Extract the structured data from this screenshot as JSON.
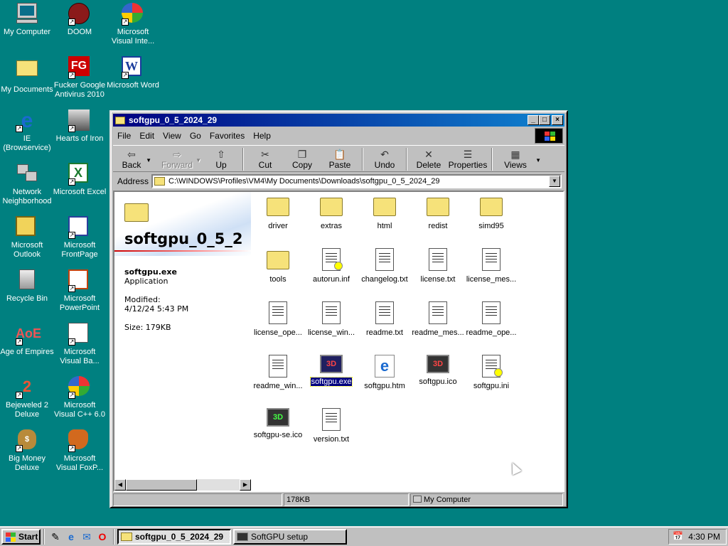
{
  "desktop": {
    "icons": [
      {
        "label": "My Computer",
        "icon": "my-computer-icon"
      },
      {
        "label": "DOOM",
        "icon": "doom-icon"
      },
      {
        "label": "Microsoft Visual Inte...",
        "icon": "visual-interdev-icon"
      },
      {
        "label": "My Documents",
        "icon": "my-documents-icon"
      },
      {
        "label": "Fucker Google Antivirus 2010",
        "icon": "antivirus-icon"
      },
      {
        "label": "Microsoft Word",
        "icon": "word-icon"
      },
      {
        "label": "IE (Browservice)",
        "icon": "ie-icon"
      },
      {
        "label": "Hearts of Iron",
        "icon": "hearts-of-iron-icon"
      },
      {
        "label": "Network Neighborhood",
        "icon": "network-icon"
      },
      {
        "label": "Microsoft Excel",
        "icon": "excel-icon"
      },
      {
        "label": "Microsoft Outlook",
        "icon": "outlook-icon"
      },
      {
        "label": "Microsoft FrontPage",
        "icon": "frontpage-icon"
      },
      {
        "label": "Recycle Bin",
        "icon": "recycle-bin-icon"
      },
      {
        "label": "Microsoft PowerPoint",
        "icon": "powerpoint-icon"
      },
      {
        "label": "Age of Empires",
        "icon": "age-of-empires-icon"
      },
      {
        "label": "Microsoft Visual Ba...",
        "icon": "visual-basic-icon"
      },
      {
        "label": "Bejeweled 2 Deluxe",
        "icon": "bejeweled-icon"
      },
      {
        "label": "Microsoft Visual C++ 6.0",
        "icon": "visual-cpp-icon"
      },
      {
        "label": "Big Money Deluxe",
        "icon": "big-money-icon"
      },
      {
        "label": "Microsoft Visual FoxP...",
        "icon": "visual-foxpro-icon"
      }
    ]
  },
  "window": {
    "title": "softgpu_0_5_2024_29",
    "menu": [
      "File",
      "Edit",
      "View",
      "Go",
      "Favorites",
      "Help"
    ],
    "toolbar": {
      "back": "Back",
      "forward": "Forward",
      "up": "Up",
      "cut": "Cut",
      "copy": "Copy",
      "paste": "Paste",
      "undo": "Undo",
      "delete": "Delete",
      "properties": "Properties",
      "views": "Views"
    },
    "address_label": "Address",
    "address_value": "C:\\WINDOWS\\Profiles\\VM4\\My Documents\\Downloads\\softgpu_0_5_2024_29",
    "info": {
      "title": "softgpu_0_5_2",
      "filename": "softgpu.exe",
      "type": "Application",
      "modified_label": "Modified:",
      "modified_value": "4/12/24 5:43 PM",
      "size": "Size: 179KB"
    },
    "files": [
      {
        "name": "driver",
        "kind": "folder"
      },
      {
        "name": "extras",
        "kind": "folder"
      },
      {
        "name": "html",
        "kind": "folder"
      },
      {
        "name": "redist",
        "kind": "folder"
      },
      {
        "name": "simd95",
        "kind": "folder"
      },
      {
        "name": "tools",
        "kind": "folder"
      },
      {
        "name": "autorun.inf",
        "kind": "config"
      },
      {
        "name": "changelog.txt",
        "kind": "text"
      },
      {
        "name": "license.txt",
        "kind": "text"
      },
      {
        "name": "license_mes...",
        "kind": "text"
      },
      {
        "name": "license_ope...",
        "kind": "text"
      },
      {
        "name": "license_win...",
        "kind": "text"
      },
      {
        "name": "readme.txt",
        "kind": "text"
      },
      {
        "name": "readme_mes...",
        "kind": "text"
      },
      {
        "name": "readme_ope...",
        "kind": "text"
      },
      {
        "name": "readme_win...",
        "kind": "text"
      },
      {
        "name": "softgpu.exe",
        "kind": "exe",
        "selected": true
      },
      {
        "name": "softgpu.htm",
        "kind": "html"
      },
      {
        "name": "softgpu.ico",
        "kind": "ico"
      },
      {
        "name": "softgpu.ini",
        "kind": "config"
      },
      {
        "name": "softgpu-se.ico",
        "kind": "ico-green"
      },
      {
        "name": "version.txt",
        "kind": "text"
      }
    ],
    "status": {
      "size": "178KB",
      "zone": "My Computer"
    }
  },
  "taskbar": {
    "start": "Start",
    "tasks": [
      "softgpu_0_5_2024_29",
      "SoftGPU setup"
    ],
    "clock": "4:30 PM"
  },
  "colors": {
    "desktop": "#008080",
    "titlebar": "#000080",
    "selection": "#000080"
  }
}
